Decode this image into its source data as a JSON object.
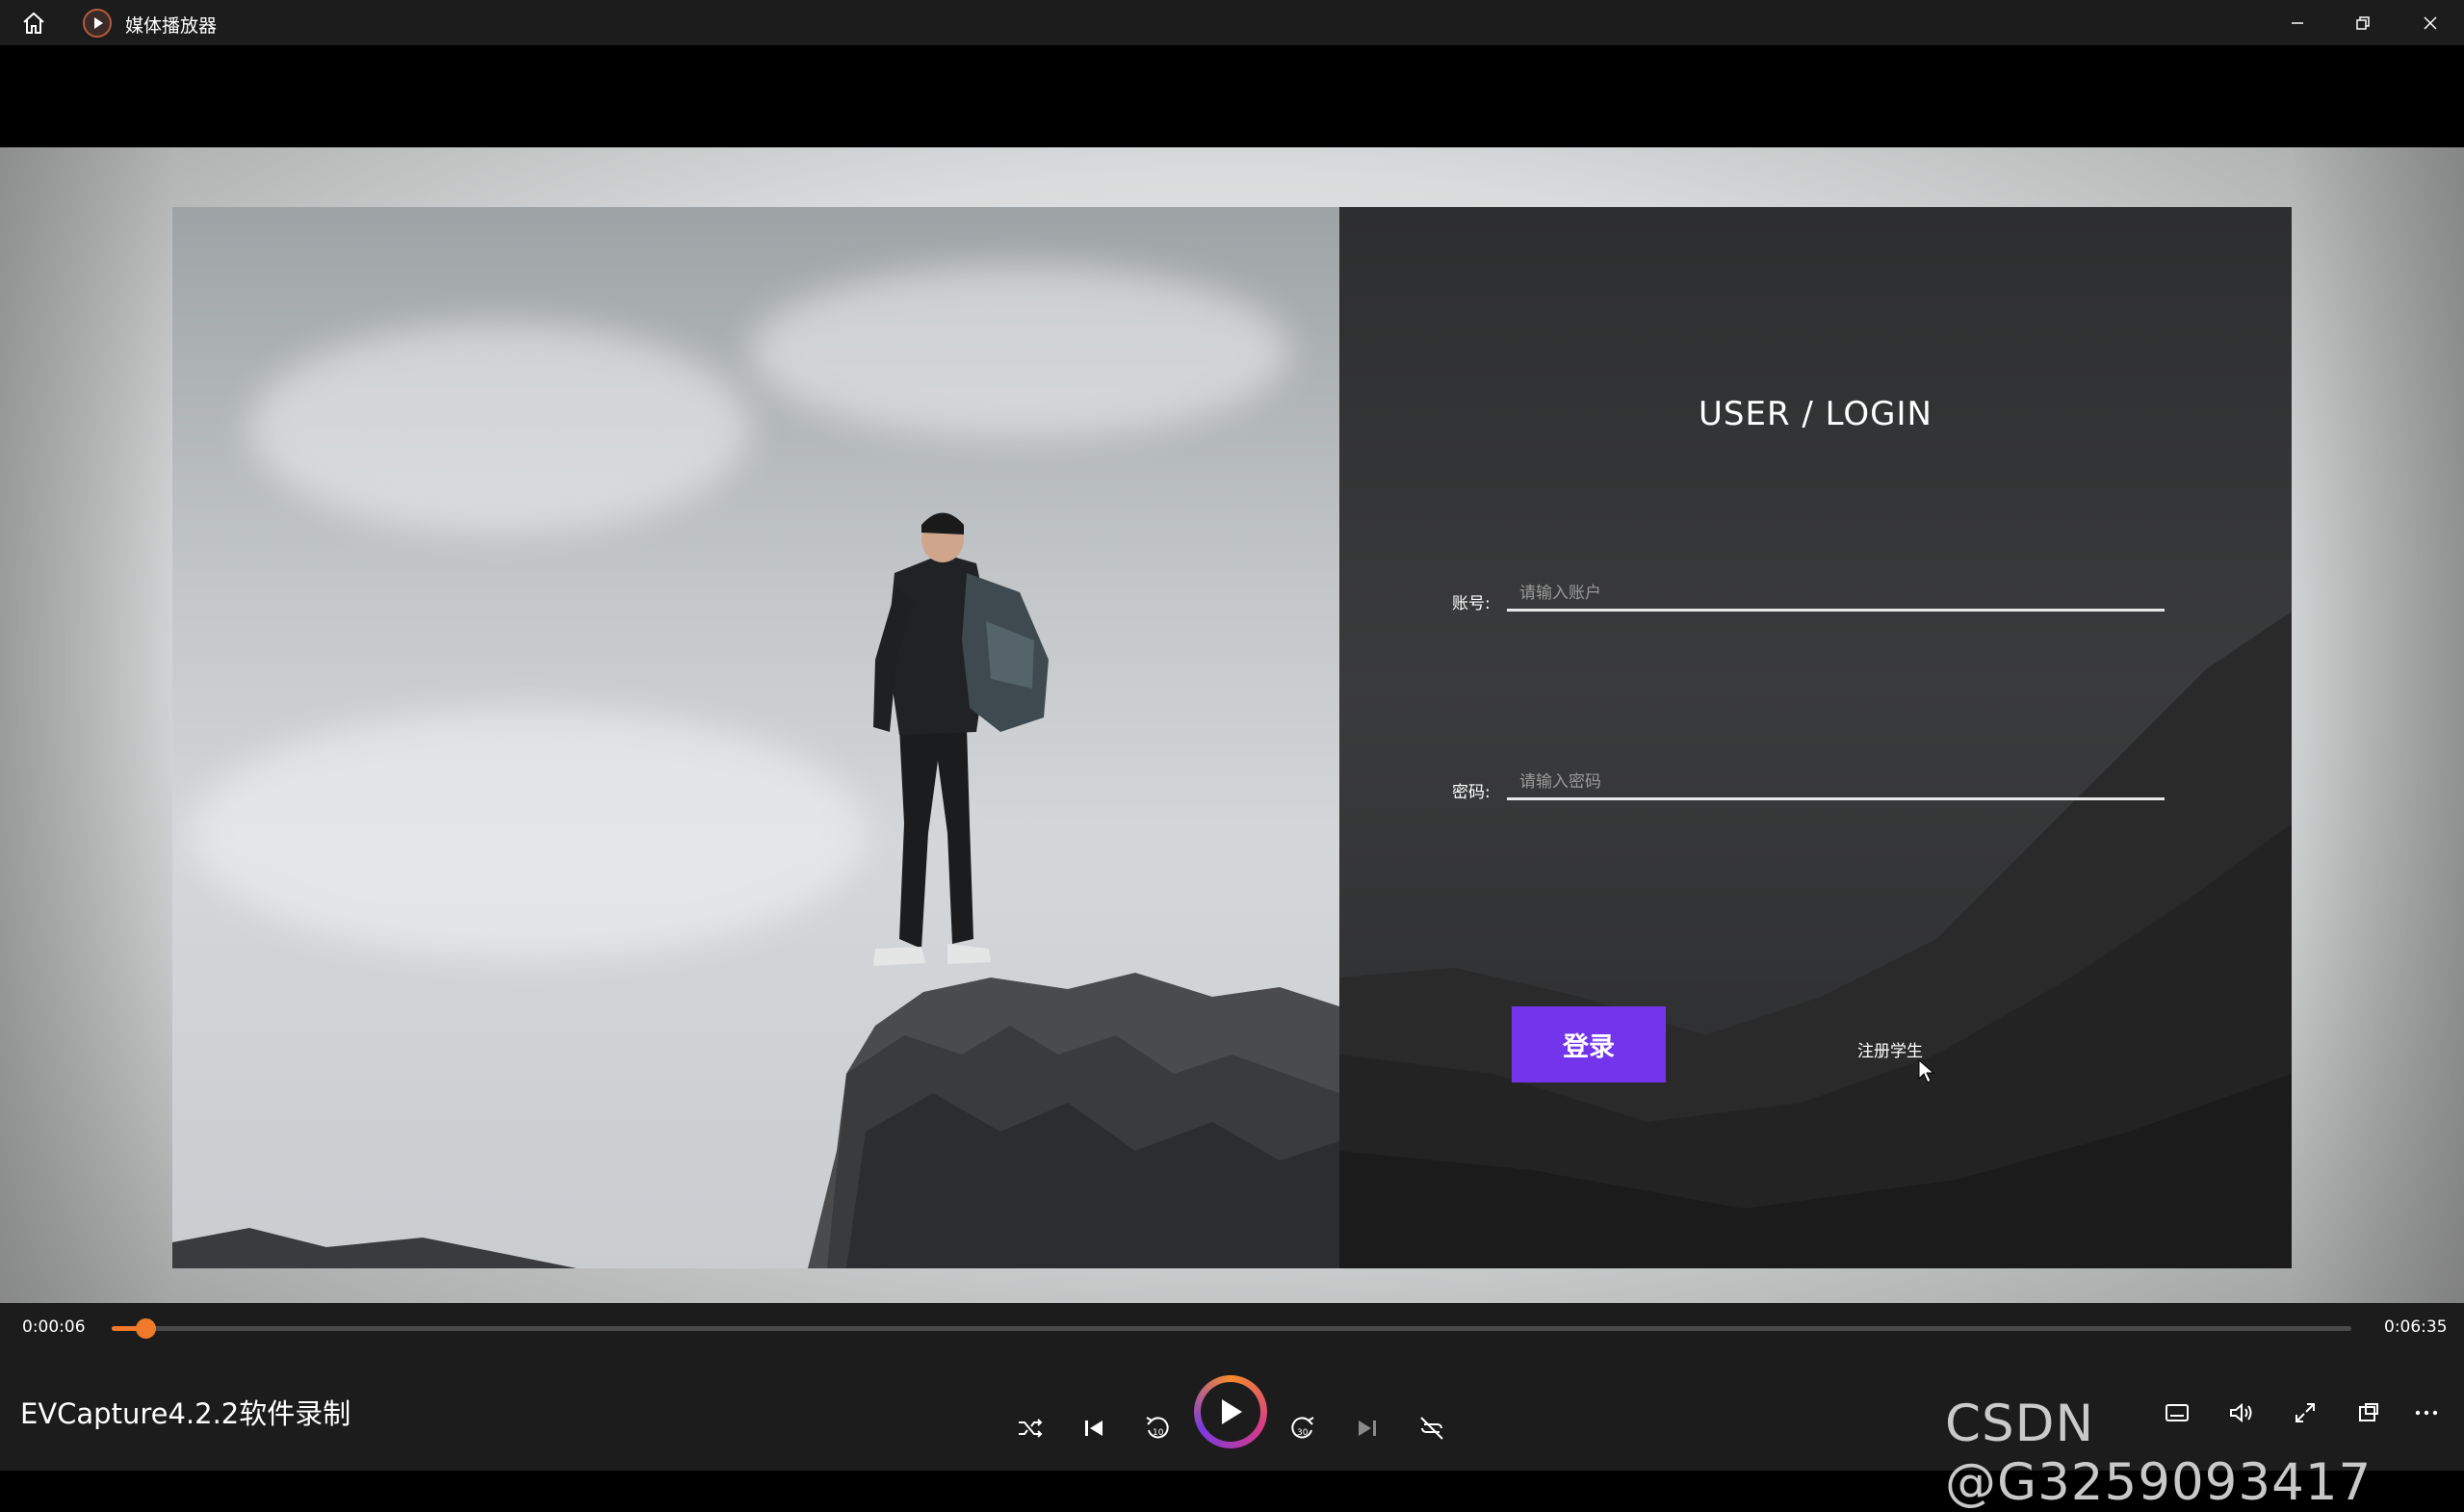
{
  "titlebar": {
    "title": "媒体播放器"
  },
  "login": {
    "title": "USER / LOGIN",
    "account_label": "账号:",
    "account_placeholder": "请输入账户",
    "password_label": "密码:",
    "password_placeholder": "请输入密码",
    "submit_label": "登录",
    "register_label": "注册学生",
    "accent_color": "#7235ec"
  },
  "player": {
    "elapsed": "0:00:06",
    "duration": "0:06:35",
    "progress_fraction": 0.015,
    "now_playing": "EVCapture4.2.2软件录制",
    "accent_color": "#f07a2a"
  },
  "watermark": "CSDN @G3259093417",
  "icons": {
    "home": "home-icon",
    "app": "media-player-icon",
    "minimize": "minimize-icon",
    "restore": "restore-icon",
    "close": "close-icon",
    "shuffle": "shuffle-icon",
    "previous": "previous-icon",
    "rewind": "rewind-10-icon",
    "play": "play-icon",
    "forward": "forward-30-icon",
    "next": "next-icon",
    "repeat": "repeat-off-icon",
    "subtitles": "subtitles-icon",
    "volume": "volume-icon",
    "fullscreen": "fullscreen-icon",
    "mini_player": "mini-player-icon",
    "more": "more-icon"
  }
}
